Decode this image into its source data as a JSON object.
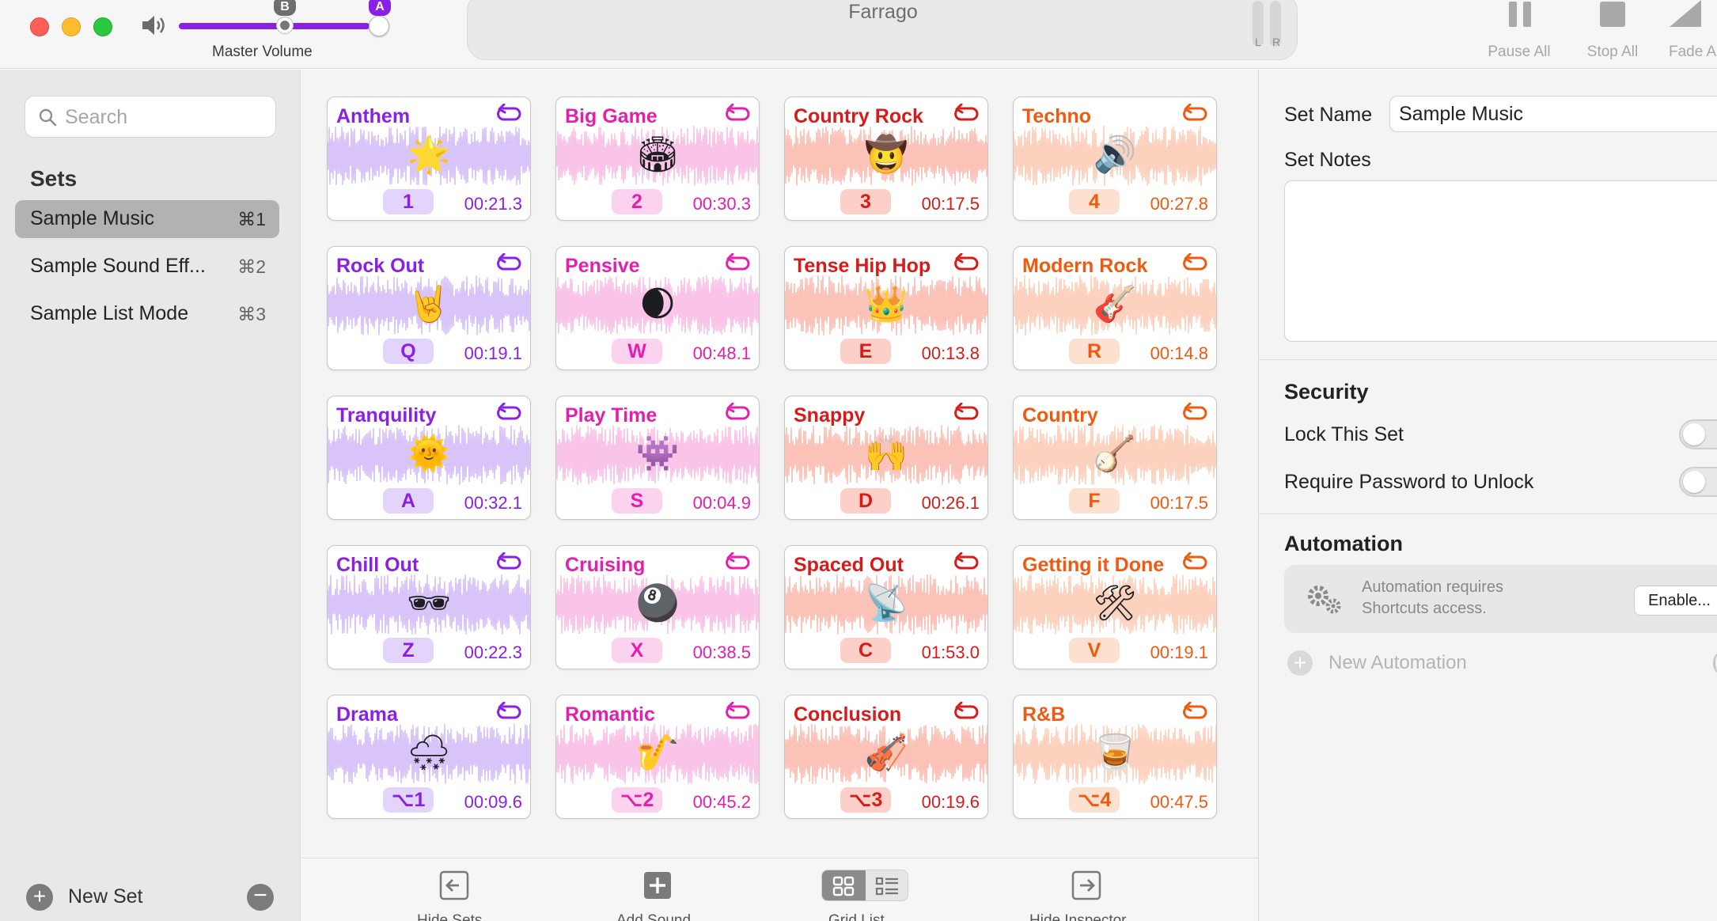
{
  "window": {
    "title": "Farrago"
  },
  "master_volume": {
    "label": "Master Volume",
    "level_percent": 95,
    "marker_b": "B",
    "marker_a": "A",
    "meter_left": "L",
    "meter_right": "R"
  },
  "toolbar": {
    "pause_all": "Pause All",
    "stop_all": "Stop All",
    "fade_all": "Fade A"
  },
  "sidebar": {
    "search_placeholder": "Search",
    "sets_heading": "Sets",
    "sets": [
      {
        "name": "Sample Music",
        "shortcut": "⌘1",
        "selected": true
      },
      {
        "name": "Sample Sound Eff...",
        "shortcut": "⌘2",
        "selected": false
      },
      {
        "name": "Sample List Mode",
        "shortcut": "⌘3",
        "selected": false
      }
    ],
    "new_set": "New Set"
  },
  "colors": {
    "purple": "#8a1fe6",
    "pink": "#e31fae",
    "red": "#d71a1a",
    "orange": "#f05a0f",
    "wave_purple": "#d8c4f8",
    "wave_pink": "#f9c4e8",
    "wave_red": "#fbc2b8",
    "wave_orange": "#fcd2bf",
    "key_purple": "#e2d4fa",
    "key_pink": "#fbd3ef",
    "key_red": "#fcd0c9",
    "key_orange": "#fde0d0"
  },
  "tiles": [
    {
      "name": "Anthem",
      "emoji": "🌟",
      "key": "1",
      "time": "00:21.3",
      "color": "purple"
    },
    {
      "name": "Big Game",
      "emoji": "🏟",
      "key": "2",
      "time": "00:30.3",
      "color": "pink"
    },
    {
      "name": "Country Rock",
      "emoji": "🤠",
      "key": "3",
      "time": "00:17.5",
      "color": "red"
    },
    {
      "name": "Techno",
      "emoji": "🔊",
      "key": "4",
      "time": "00:27.8",
      "color": "orange"
    },
    {
      "name": "Rock Out",
      "emoji": "🤘",
      "key": "Q",
      "time": "00:19.1",
      "color": "purple"
    },
    {
      "name": "Pensive",
      "emoji": "🌒",
      "key": "W",
      "time": "00:48.1",
      "color": "pink"
    },
    {
      "name": "Tense Hip Hop",
      "emoji": "👑",
      "key": "E",
      "time": "00:13.8",
      "color": "red"
    },
    {
      "name": "Modern Rock",
      "emoji": "🎸",
      "key": "R",
      "time": "00:14.8",
      "color": "orange"
    },
    {
      "name": "Tranquility",
      "emoji": "🌞",
      "key": "A",
      "time": "00:32.1",
      "color": "purple"
    },
    {
      "name": "Play Time",
      "emoji": "👾",
      "key": "S",
      "time": "00:04.9",
      "color": "pink"
    },
    {
      "name": "Snappy",
      "emoji": "🙌",
      "key": "D",
      "time": "00:26.1",
      "color": "red"
    },
    {
      "name": "Country",
      "emoji": "🪕",
      "key": "F",
      "time": "00:17.5",
      "color": "orange"
    },
    {
      "name": "Chill Out",
      "emoji": "🕶",
      "key": "Z",
      "time": "00:22.3",
      "color": "purple"
    },
    {
      "name": "Cruising",
      "emoji": "🎱",
      "key": "X",
      "time": "00:38.5",
      "color": "pink"
    },
    {
      "name": "Spaced Out",
      "emoji": "📡",
      "key": "C",
      "time": "01:53.0",
      "color": "red"
    },
    {
      "name": "Getting it Done",
      "emoji": "🛠",
      "key": "V",
      "time": "00:19.1",
      "color": "orange"
    },
    {
      "name": "Drama",
      "emoji": "🌨",
      "key": "⌥1",
      "time": "00:09.6",
      "color": "purple"
    },
    {
      "name": "Romantic",
      "emoji": "🎷",
      "key": "⌥2",
      "time": "00:45.2",
      "color": "pink"
    },
    {
      "name": "Conclusion",
      "emoji": "🎻",
      "key": "⌥3",
      "time": "00:19.6",
      "color": "red"
    },
    {
      "name": "R&B",
      "emoji": "🥃",
      "key": "⌥4",
      "time": "00:47.5",
      "color": "orange"
    }
  ],
  "grid_footer": {
    "hide_sets": "Hide Sets",
    "add_sound": "Add Sound",
    "grid_list": "Grid  List",
    "hide_inspector": "Hide Inspector"
  },
  "inspector": {
    "set_name_label": "Set Name",
    "set_name_value": "Sample Music",
    "set_notes_label": "Set Notes",
    "set_notes_value": "",
    "security_heading": "Security",
    "lock_label": "Lock This Set",
    "lock_on": false,
    "password_label": "Require Password to Unlock",
    "password_on": false,
    "automation_heading": "Automation",
    "automation_notice": "Automation requires Shortcuts access.",
    "enable_button": "Enable...",
    "new_automation": "New Automation"
  }
}
